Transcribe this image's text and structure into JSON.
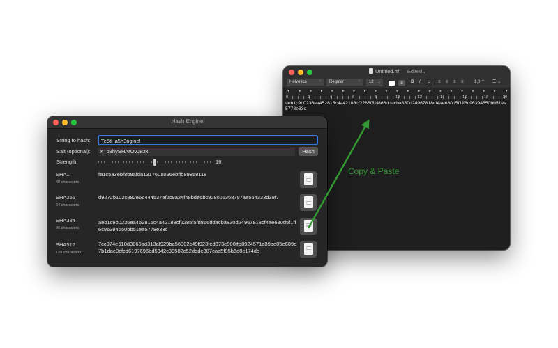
{
  "hash_window": {
    "title": "Hash Engine",
    "string_label": "String to hash:",
    "string_value": "Te5tHa5h3ngine!",
    "salt_label": "Salt (optional):",
    "salt_value": "XTp8hySHArOvJBzx",
    "hash_button": "Hash",
    "strength_label": "Strength:",
    "strength_value": "16",
    "strength_level_fraction": 0.5,
    "hashes": [
      {
        "name": "SHA1",
        "count": "40 characters",
        "value": "fa1c5a3ebf8b8afda131760a096ebffb89858118"
      },
      {
        "name": "SHA256",
        "count": "64 characters",
        "value": "d9272b102c882e66444537ef2c9a24f48bde6bc928c06368797ae554333d39f7"
      },
      {
        "name": "SHA384",
        "count": "96 characters",
        "value": "aeb1c9b0236ea452815c4a42188cf2285f5fd866ddacba830d24967818cf4ae680d5f1ff6c96394550bb51ea5778e33c"
      },
      {
        "name": "SHA512",
        "count": "128 characters",
        "value": "7cc974e618d3065ad313af929ba56002c49f923fed373e900ffb8924571a89be05e609d7b1dae0cfcd6197696bd5342c99582c52ddde887caa5f95b6d8c174dc"
      }
    ]
  },
  "rtf_window": {
    "filename": "Untitled.rtf",
    "separator": "—",
    "status": "Edited",
    "font_family": "Helvetica",
    "font_style": "Regular",
    "font_size": "12",
    "bold": "B",
    "italic": "I",
    "underline": "U",
    "line_spacing": "1,0",
    "ruler_numbers": [
      "0",
      "2",
      "4",
      "6",
      "8",
      "10",
      "12",
      "14",
      "16",
      "18",
      "20"
    ],
    "body_text": "aeb1c9b0236ea452815c4a42188cf2285f5fd866ddacba830d24967818cf4ae680d5f1ff6c96394550bb51ea5778e33c"
  },
  "annotation": {
    "label": "Copy & Paste",
    "color": "#339933"
  },
  "colors": {
    "focus_ring": "#3b79d6",
    "close": "#fe5f57",
    "minimize": "#febc2e",
    "zoom": "#28c840"
  },
  "icons": [
    "copy-doc-icon",
    "document-icon",
    "chevron-down-icon",
    "align-left-icon",
    "align-center-icon",
    "align-justify-icon",
    "align-right-icon",
    "list-icon"
  ]
}
